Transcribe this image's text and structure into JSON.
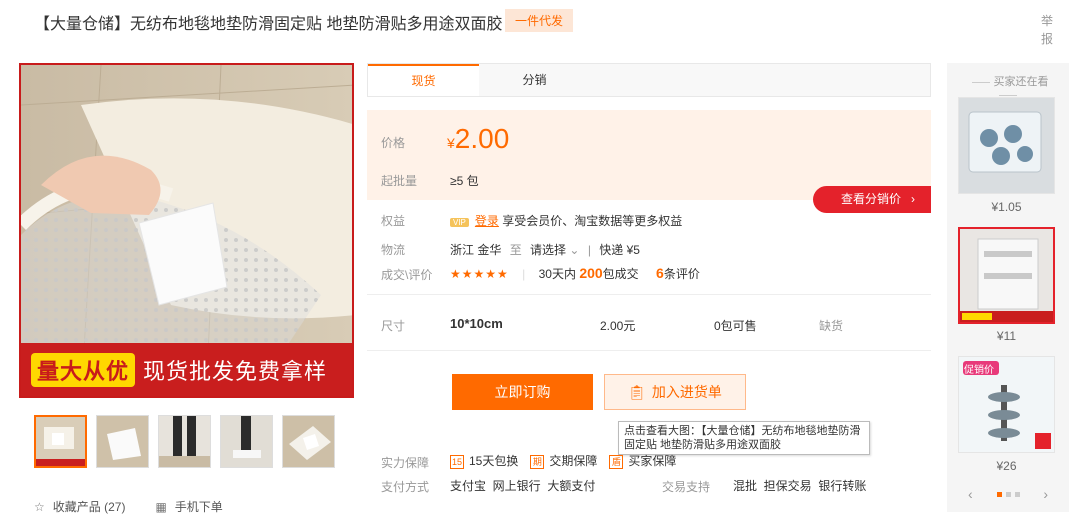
{
  "header": {
    "title": "【大量仓储】无纺布地毯地垫防滑固定贴 地垫防滑贴多用途双面胶",
    "badge": "一件代发",
    "report": "举报"
  },
  "gallery": {
    "banner_logo": "量大从优",
    "banner_text": "现货批发免费拿样",
    "thumbnail_count": 5
  },
  "actions": {
    "favorite": "收藏产品 (27)",
    "mobile_order": "手机下单"
  },
  "tabs": [
    {
      "label": "现货",
      "active": true
    },
    {
      "label": "分销",
      "active": false
    }
  ],
  "price": {
    "label": "价格",
    "currency": "¥",
    "value": "2.00",
    "moq_label": "起批量",
    "moq_value": "≥5 包"
  },
  "distribution_button": "查看分销价",
  "rights": {
    "label": "权益",
    "vip": "VIP",
    "login": "登录",
    "text": "享受会员价、淘宝数据等更多权益"
  },
  "logistics": {
    "label": "物流",
    "origin": "浙江 金华",
    "to": "至",
    "destination": "请选择",
    "express": "快递 ¥5"
  },
  "evaluation": {
    "label": "成交\\评价",
    "stars": "★★★★★",
    "deals_prefix": "30天内",
    "deals_count": "200",
    "deals_suffix": "包成交",
    "reviews_count": "6",
    "reviews_suffix": "条评价"
  },
  "sku": {
    "label": "尺寸",
    "size": "10*10cm",
    "price": "2.00元",
    "stock": "0包可售",
    "status": "缺货"
  },
  "buttons": {
    "order": "立即订购",
    "cart": "加入进货单"
  },
  "tooltip": "点击查看大图：【大量仓储】无纺布地毯地垫防滑固定贴 地垫防滑贴多用途双面胶",
  "guarantee": {
    "label": "实力保障",
    "items": [
      {
        "icon": "15",
        "text": "15天包换"
      },
      {
        "icon": "期",
        "text": "交期保障"
      },
      {
        "icon": "盾",
        "text": "买家保障"
      }
    ]
  },
  "payment": {
    "label": "支付方式",
    "methods": "支付宝  网上银行  大额支付"
  },
  "trade": {
    "label": "交易支持",
    "methods": "混批  担保交易  银行转账"
  },
  "sidebar": {
    "title": "买家还在看",
    "items": [
      {
        "price": "¥1.05"
      },
      {
        "price": "¥11"
      },
      {
        "price": "¥26",
        "tag": "促销价"
      }
    ]
  },
  "colors": {
    "accent": "#ff6a00",
    "red": "#e4222b",
    "banner": "#c91e1e"
  }
}
